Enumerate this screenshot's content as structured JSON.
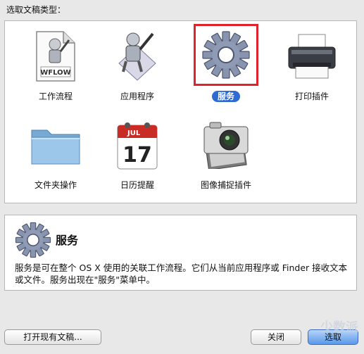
{
  "header": {
    "label": "选取文稿类型："
  },
  "templates": [
    {
      "label": "工作流程",
      "icon": "workflow-document-icon",
      "badge": "WFLOW"
    },
    {
      "label": "应用程序",
      "icon": "robot-application-icon"
    },
    {
      "label": "服务",
      "icon": "gear-icon",
      "selected": true
    },
    {
      "label": "打印插件",
      "icon": "printer-icon"
    },
    {
      "label": "文件夹操作",
      "icon": "folder-icon"
    },
    {
      "label": "日历提醒",
      "icon": "calendar-icon",
      "month": "JUL",
      "day": "17"
    },
    {
      "label": "图像捕捉插件",
      "icon": "camera-icon"
    }
  ],
  "description": {
    "icon": "gear-icon",
    "title": "服务",
    "text": "服务是可在整个 OS X 使用的关联工作流程。它们从当前应用程序或 Finder 接收文本或文件。服务出现在\"服务\"菜单中。"
  },
  "buttons": {
    "open_existing": "打开现有文稿...",
    "close": "关闭",
    "choose": "选取"
  },
  "watermark": "少数派",
  "colors": {
    "selection_border": "#e0232a",
    "selection_label_bg": "#2f6ad3",
    "primary_button": "#5a98ea"
  }
}
